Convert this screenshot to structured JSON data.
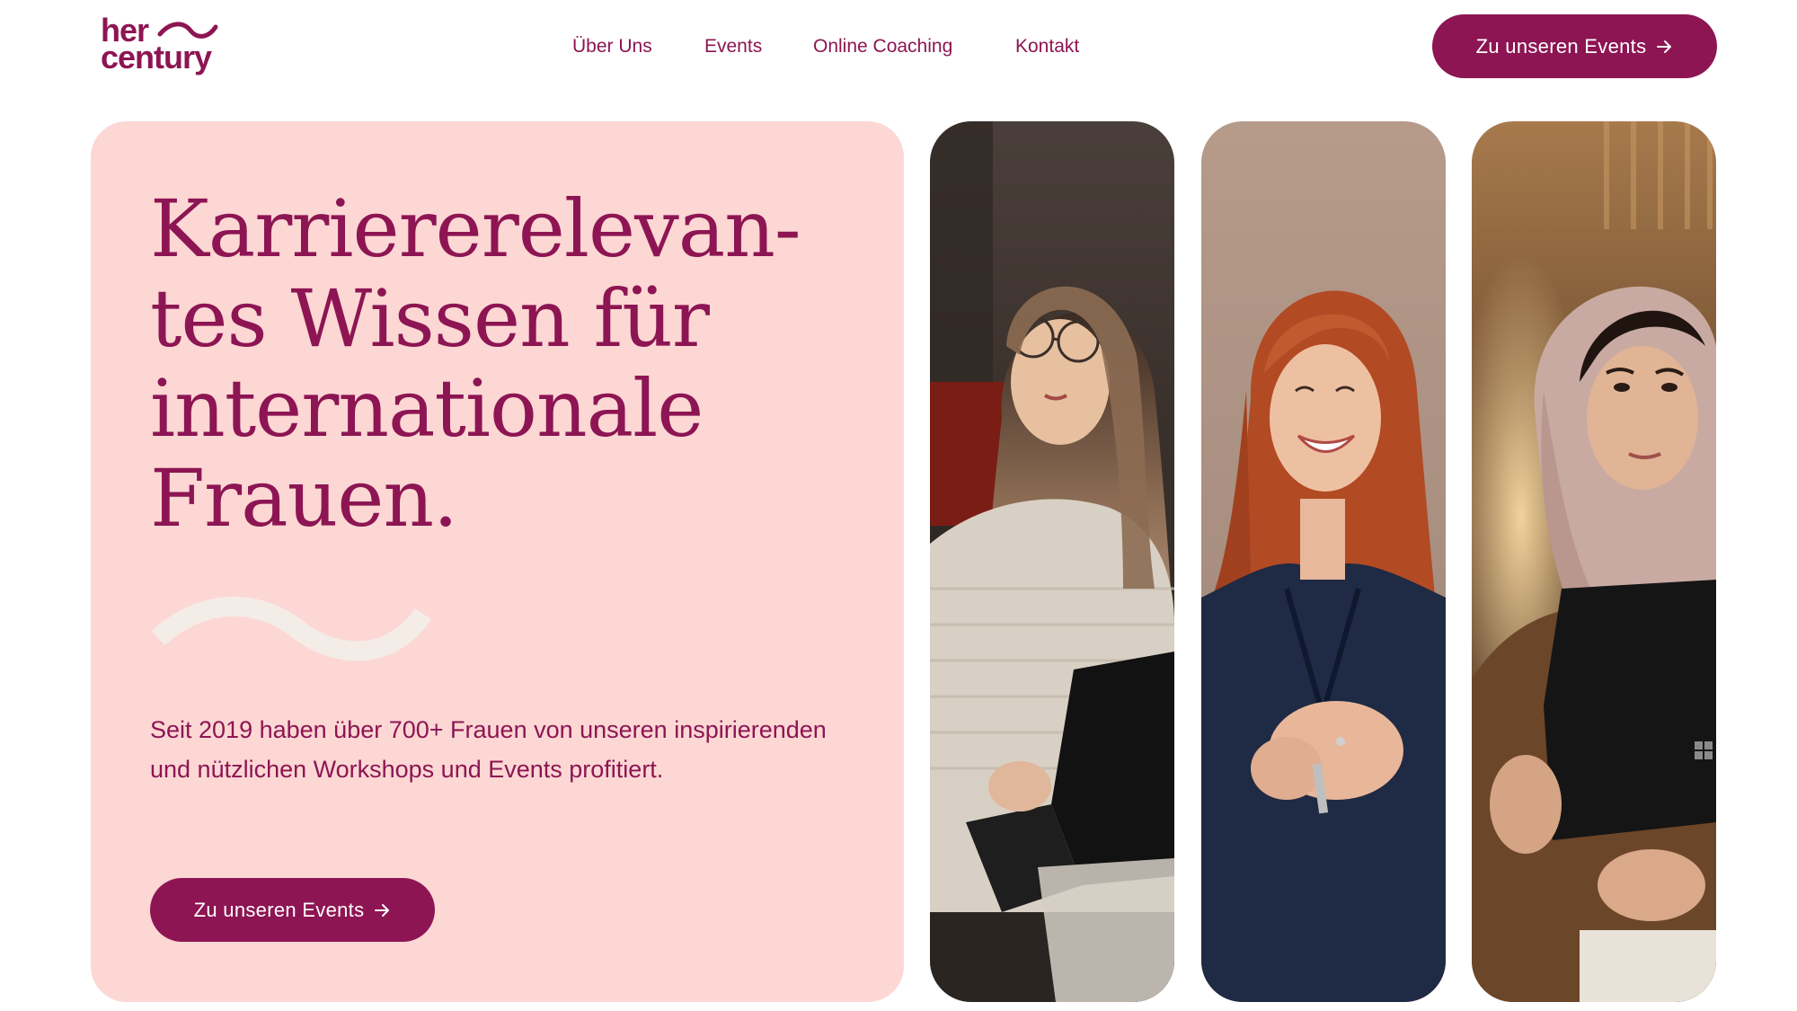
{
  "brand": {
    "logo_line1": "her",
    "logo_line2": "century",
    "primary_color": "#8d1553",
    "hero_bg_color": "#fcd7d4"
  },
  "nav": {
    "items": [
      {
        "label": "Über Uns"
      },
      {
        "label": "Events"
      },
      {
        "label": "Online Coaching"
      },
      {
        "label": "Kontakt"
      }
    ],
    "cta_label": "Zu unseren Events",
    "cta_icon": "arrow-right-icon"
  },
  "hero": {
    "headline_lines": [
      "Karriererelevan-",
      "tes Wissen für",
      "internationale",
      "Frauen."
    ],
    "subtext": "Seit 2019 haben über 700+ Frauen von unseren inspirierenden und nützlichen Workshops und Events profitiert.",
    "cta_label": "Zu unseren Events",
    "cta_icon": "arrow-right-icon",
    "decoration_icon": "wave-icon"
  },
  "photos": [
    {
      "name": "woman-with-glasses-laptop-photo"
    },
    {
      "name": "smiling-red-haired-woman-photo"
    },
    {
      "name": "woman-with-hijab-laptop-photo"
    }
  ]
}
